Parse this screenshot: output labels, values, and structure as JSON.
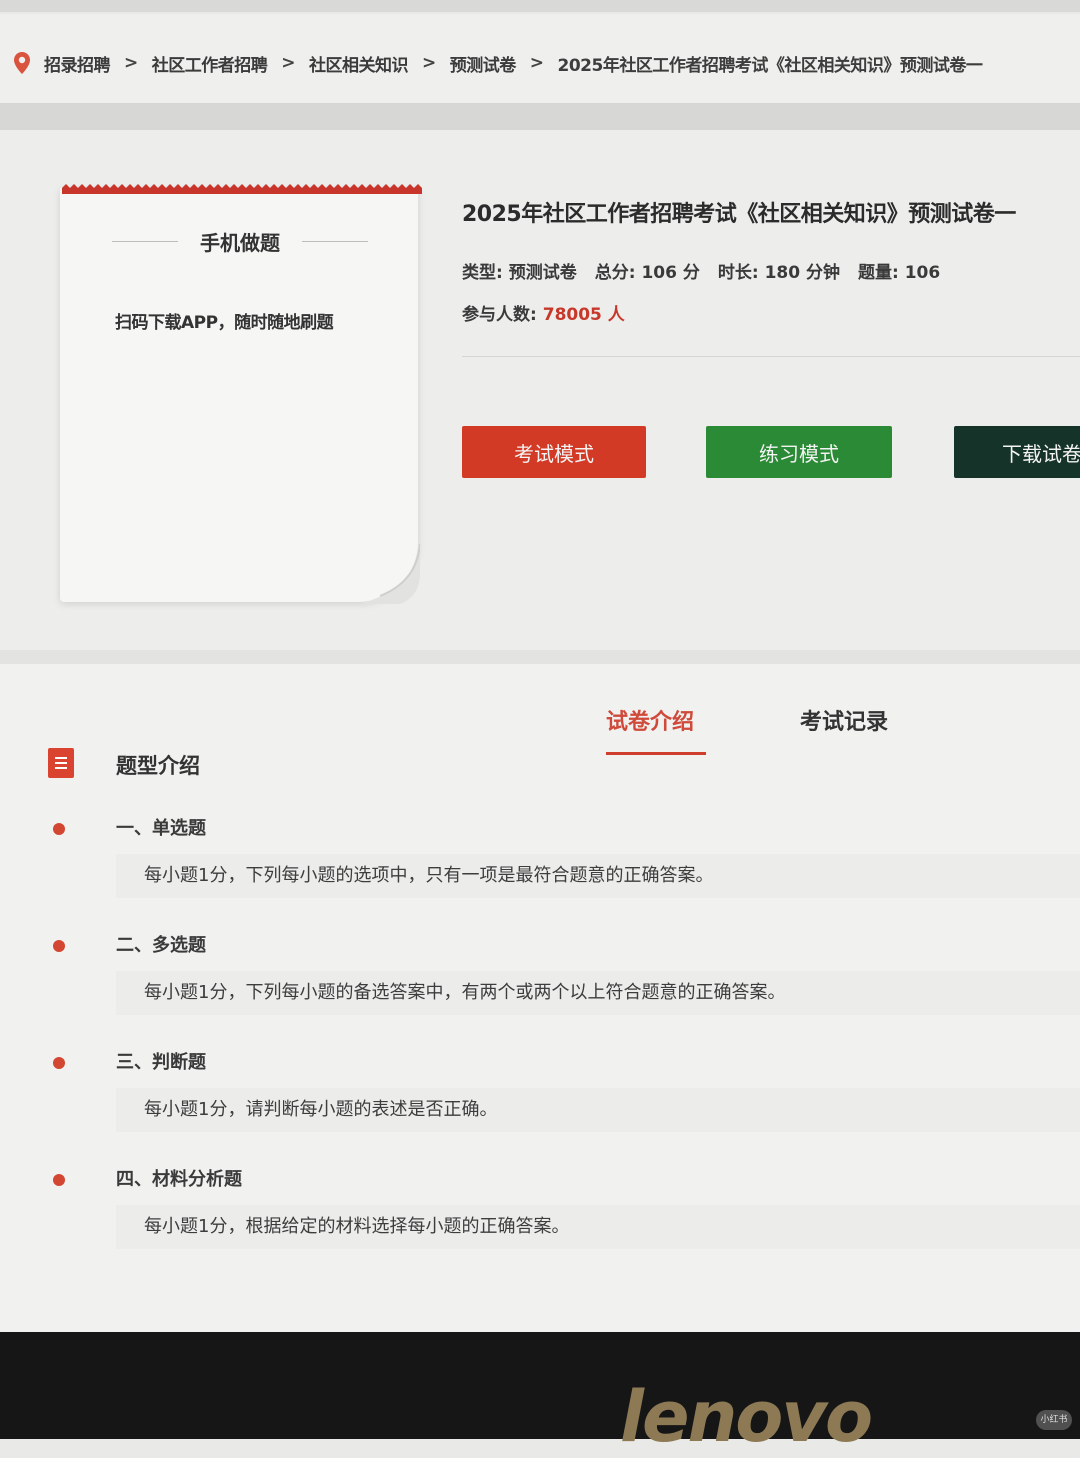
{
  "breadcrumb": {
    "items": [
      "招录招聘",
      "社区工作者招聘",
      "社区相关知识",
      "预测试卷"
    ],
    "separator": ">",
    "current": "2025年社区工作者招聘考试《社区相关知识》预测试卷一"
  },
  "phone_card": {
    "title": "手机做题",
    "subtitle": "扫码下载APP，随时随地刷题"
  },
  "exam": {
    "title": "2025年社区工作者招聘考试《社区相关知识》预测试卷一",
    "meta": [
      {
        "label": "类型",
        "value": "预测试卷"
      },
      {
        "label": "总分",
        "value": "106 分"
      },
      {
        "label": "时长",
        "value": "180 分钟"
      },
      {
        "label": "题量",
        "value": "106"
      }
    ],
    "participants_label": "参与人数:",
    "participants_value": "78005 人",
    "buttons": {
      "exam_mode": "考试模式",
      "practice_mode": "练习模式",
      "download": "下载试卷"
    }
  },
  "tabs": {
    "intro": "试卷介绍",
    "records": "考试记录",
    "active": "intro"
  },
  "section": {
    "title": "题型介绍",
    "question_types": [
      {
        "name": "一、单选题",
        "desc": "每小题1分，下列每小题的选项中，只有一项是最符合题意的正确答案。"
      },
      {
        "name": "二、多选题",
        "desc": "每小题1分，下列每小题的备选答案中，有两个或两个以上符合题意的正确答案。"
      },
      {
        "name": "三、判断题",
        "desc": "每小题1分，请判断每小题的表述是否正确。"
      },
      {
        "name": "四、材料分析题",
        "desc": "每小题1分，根据给定的材料选择每小题的正确答案。"
      }
    ]
  },
  "device": {
    "logo": "lenovo",
    "watermark": "小红书"
  },
  "colors": {
    "accent_red": "#d33a25",
    "practice_green": "#2b8a36",
    "download_dark": "#16332a",
    "count_red": "#c7382a"
  }
}
